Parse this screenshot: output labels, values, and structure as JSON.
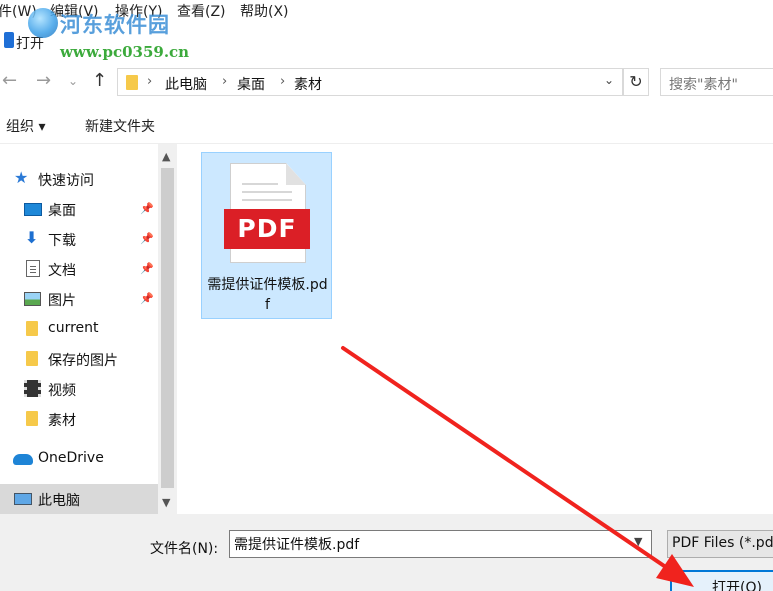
{
  "window": {
    "menu": [
      "件(W)",
      "编辑(V)",
      "操作(Y)",
      "查看(Z)",
      "帮助(X)"
    ],
    "dialog_title": "打开"
  },
  "watermark": {
    "name": "河东软件园",
    "url": "www.pc0359.cn"
  },
  "navigation": {
    "back_icon": "arrow-left-icon",
    "forward_icon": "arrow-right-icon",
    "recent_icon": "chevron-down-icon",
    "up_icon": "arrow-up-icon",
    "breadcrumb": [
      "此电脑",
      "桌面",
      "素材"
    ],
    "refresh_icon": "refresh-icon",
    "search_placeholder": "搜索\"素材\""
  },
  "toolbar": {
    "organize_label": "组织 ▾",
    "new_folder_label": "新建文件夹"
  },
  "sidebar": {
    "items": [
      {
        "label": "快速访问",
        "icon": "star-icon",
        "pinned": false
      },
      {
        "label": "桌面",
        "icon": "desktop-icon",
        "pinned": true
      },
      {
        "label": "下载",
        "icon": "download-icon",
        "pinned": true
      },
      {
        "label": "文档",
        "icon": "document-icon",
        "pinned": true
      },
      {
        "label": "图片",
        "icon": "picture-icon",
        "pinned": true
      },
      {
        "label": "current",
        "icon": "folder-icon",
        "pinned": false
      },
      {
        "label": "保存的图片",
        "icon": "folder-icon",
        "pinned": false
      },
      {
        "label": "视频",
        "icon": "video-icon",
        "pinned": false
      },
      {
        "label": "素材",
        "icon": "folder-icon",
        "pinned": false
      },
      {
        "label": "OneDrive",
        "icon": "cloud-icon",
        "pinned": false
      },
      {
        "label": "此电脑",
        "icon": "computer-icon",
        "pinned": false,
        "selected": true
      }
    ]
  },
  "files": [
    {
      "name": "需提供证件模板.pdf",
      "type_badge": "PDF",
      "selected": true
    }
  ],
  "bottom": {
    "filename_label": "文件名(N):",
    "filename_value": "需提供证件模板.pdf",
    "filter_value": "PDF Files (*.pdf)",
    "open_label": "打开(O)"
  },
  "colors": {
    "selection_bg": "#cce8ff",
    "pdf_red": "#db1f26",
    "annotation_arrow": "#f0231e",
    "accent": "#0078d7"
  }
}
